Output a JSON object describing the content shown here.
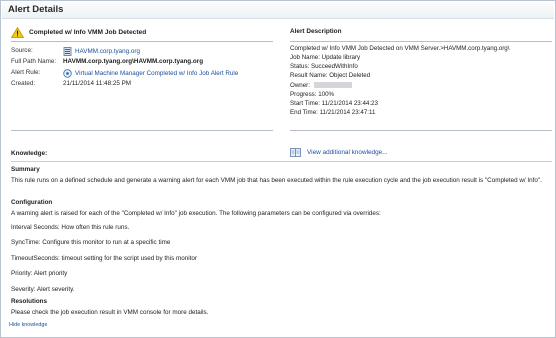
{
  "window": {
    "title": "Alert Details"
  },
  "alert": {
    "name": "Completed w/ Info VMM Job Detected"
  },
  "properties": {
    "source_label": "Source:",
    "source_value": "HAVMM.corp.tyang.org",
    "full_path_label": "Full Path Name:",
    "full_path_value": "HAVMM.corp.tyang.org\\HAVMM.corp.tyang.org",
    "alert_rule_label": "Alert Rule:",
    "alert_rule_value": "Virtual Machine Manager Completed w/ Info Job Alert Rule",
    "created_label": "Created:",
    "created_value": "21/11/2014 11:48:25 PM"
  },
  "description": {
    "title": "Alert Description",
    "lines": [
      "Completed w/ Info VMM Job Detected on VMM Server.>HAVMM.corp.tyang.org\\",
      "Job Name: Update library",
      "Status: SucceedWithInfo",
      "Result Name: Object Deleted",
      "Owner:",
      "Progress: 100%",
      "Start Time: 11/21/2014 23:44:23",
      "End Time: 11/21/2014 23:47:11"
    ]
  },
  "knowledge": {
    "title": "Knowledge:",
    "view_link": "View additional knowledge...",
    "summary_heading": "Summary",
    "summary_text": "This rule runs on a defined schedule and generate a warning alert for each VMM job that has been executed within the rule execution cycle and the job execution result is \"Completed w/ Info\".",
    "config_heading": "Configuration",
    "config_intro": "A warning alert is raised for each of the \"Completed w/ Info\" job execution. The following parameters can be configured via overrides:",
    "param_interval": "Interval Seconds: How often this rule runs.",
    "param_sync": "SyncTime: Configure this monitor to run at a specific time",
    "param_timeout": "TimeoutSeconds: timeout setting for the script used by this monitor",
    "param_priority": "Priority: Alert priority",
    "param_severity": "Severity: Alert severity.",
    "resolutions_heading": "Resolutions",
    "resolutions_text": "Please check the job execution result in VMM console for more details.",
    "hide_link": "Hide knowledge"
  }
}
